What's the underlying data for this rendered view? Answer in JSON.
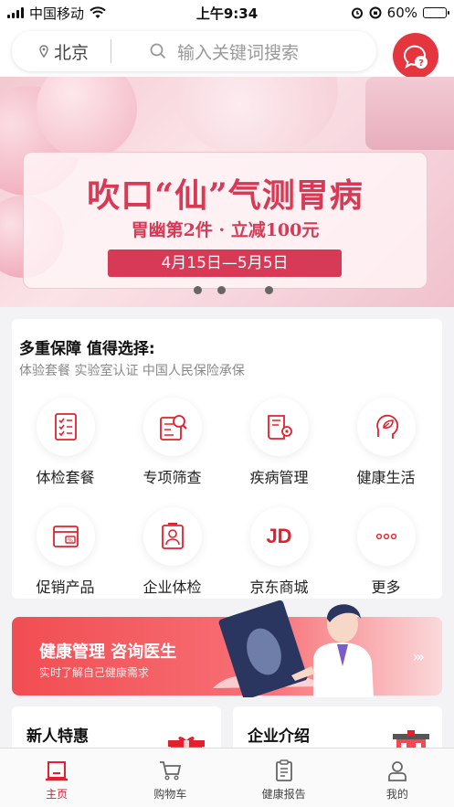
{
  "status": {
    "carrier": "中国移动",
    "time": "上午9:34",
    "battery": "60%",
    "battery_level": 0.6
  },
  "header": {
    "city": "北京",
    "search_placeholder": "输入关键词搜索"
  },
  "banner": {
    "title": "吹口“仙”气测胃病",
    "subtitle": "胃幽第2件 · 立减100元",
    "date": "4月15日—5月5日",
    "page_count": 4,
    "active_page": 2
  },
  "services": {
    "heading": "多重保障 值得选择:",
    "subheading": "体验套餐 实验室认证 中国人民保险承保",
    "items": [
      {
        "label": "体检套餐",
        "icon": "checklist-icon"
      },
      {
        "label": "专项筛查",
        "icon": "screening-icon"
      },
      {
        "label": "疾病管理",
        "icon": "disease-book-icon"
      },
      {
        "label": "健康生活",
        "icon": "healthy-life-icon"
      },
      {
        "label": "促销产品",
        "icon": "promotion-card-icon"
      },
      {
        "label": "企业体检",
        "icon": "enterprise-icon"
      },
      {
        "label": "京东商城",
        "icon": "jd-logo-icon",
        "logo_text": "JD"
      },
      {
        "label": "更多",
        "icon": "more-icon"
      }
    ]
  },
  "health_banner": {
    "title": "健康管理 咨询医生",
    "subtitle": "实时了解自己健康需求"
  },
  "promos": {
    "left_title": "新人特惠",
    "right_title": "企业介绍"
  },
  "tabbar": {
    "items": [
      {
        "label": "主页",
        "icon": "home-icon",
        "active": true
      },
      {
        "label": "购物车",
        "icon": "cart-icon",
        "active": false
      },
      {
        "label": "健康报告",
        "icon": "report-icon",
        "active": false
      },
      {
        "label": "我的",
        "icon": "user-icon",
        "active": false
      }
    ]
  },
  "colors": {
    "brand_red": "#e3202c",
    "banner_pink": "#d63a55"
  }
}
